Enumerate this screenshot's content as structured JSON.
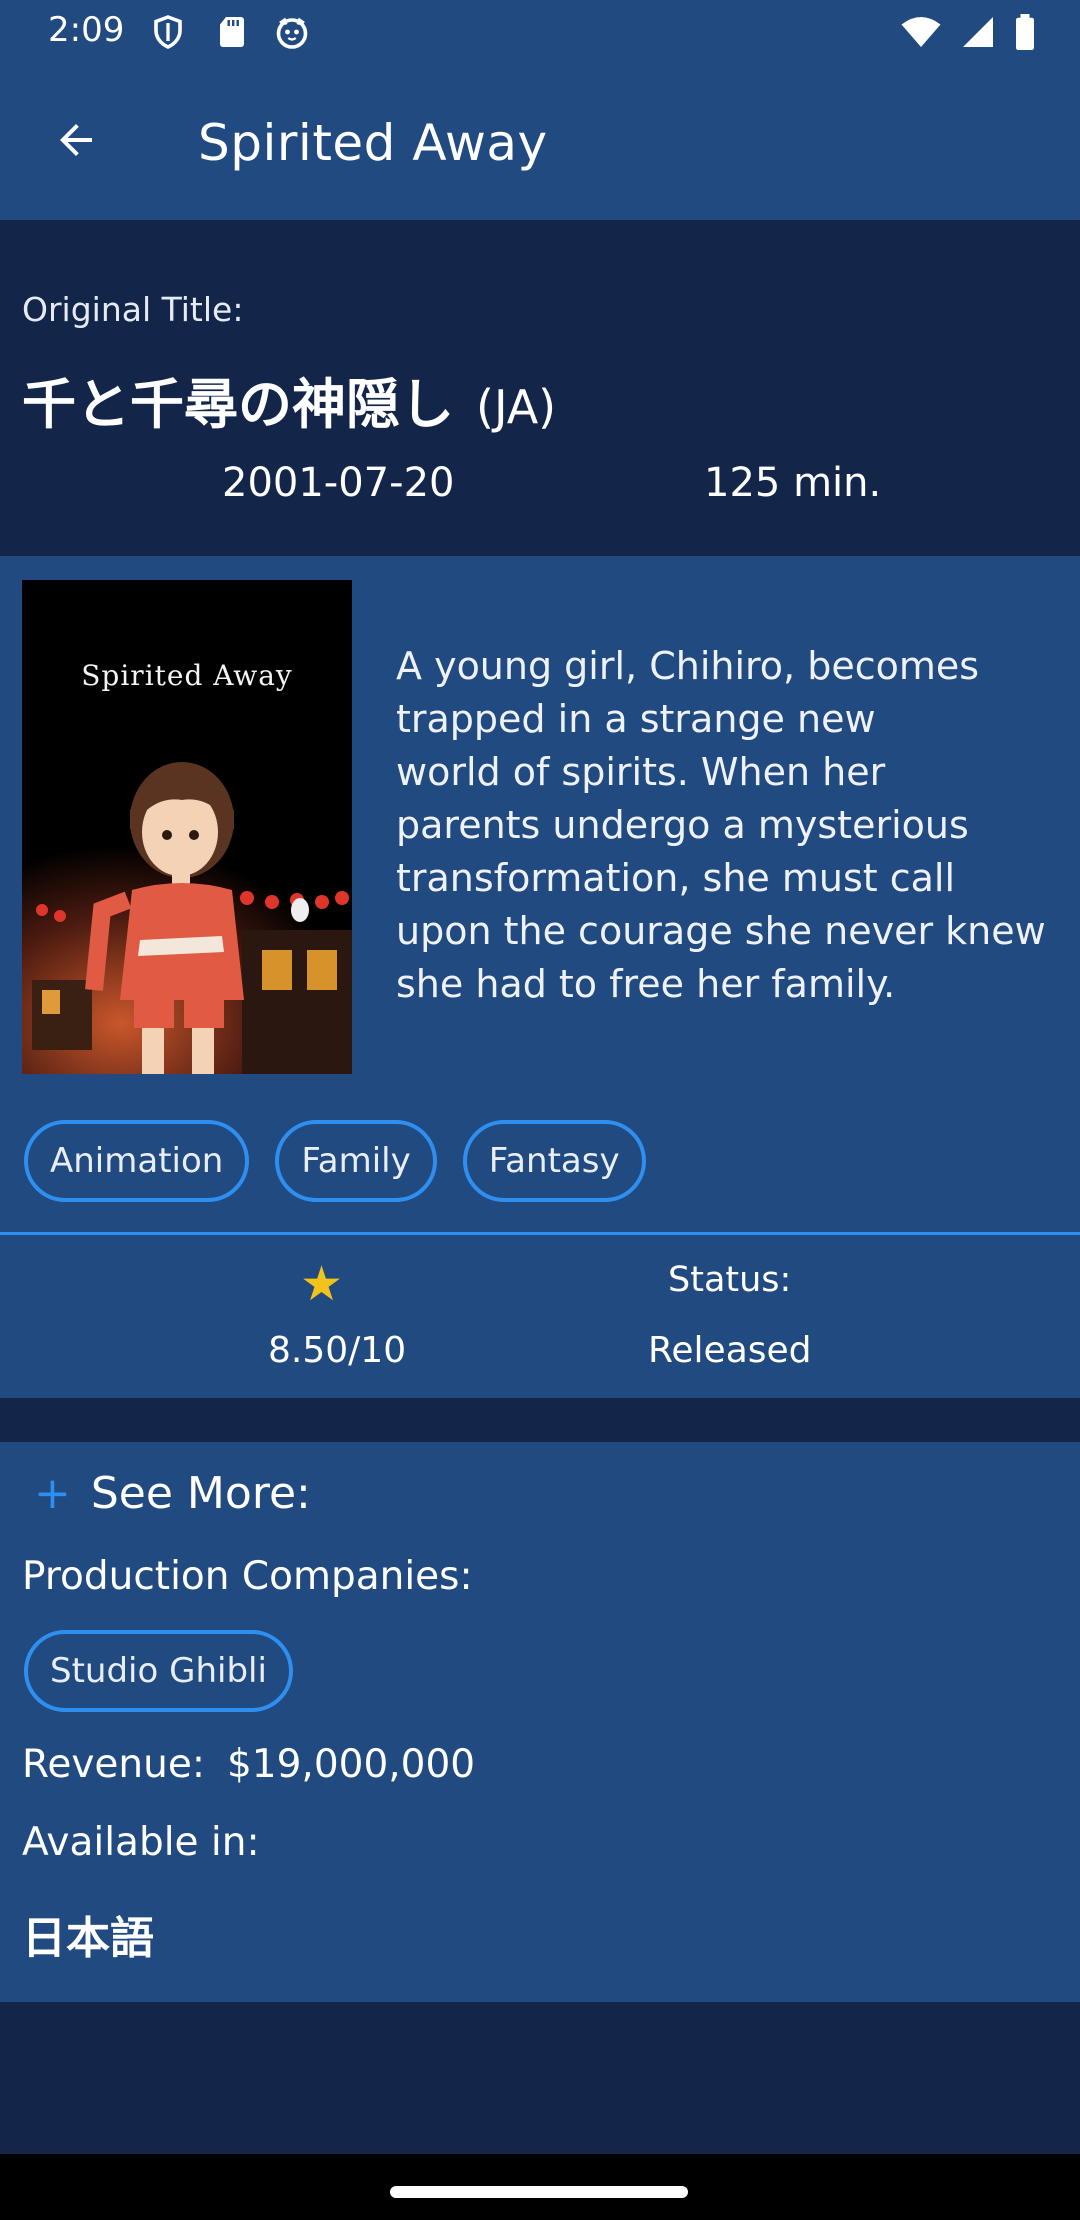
{
  "status_bar": {
    "time": "2:09",
    "left_icons": [
      "shield-icon",
      "sd-card-icon",
      "cat-face-icon"
    ],
    "right_icons": [
      "wifi-icon",
      "cell-signal-icon",
      "battery-icon"
    ]
  },
  "app_bar": {
    "back_icon": "arrow-back-icon",
    "title": "Spirited Away"
  },
  "header": {
    "original_title_label": "Original Title:",
    "original_title": "千と千尋の神隠し",
    "original_language": "(JA)",
    "release_date": "2001-07-20",
    "runtime": "125 min."
  },
  "poster": {
    "title_text": "Spirited Away"
  },
  "overview": "A young girl, Chihiro, becomes\ntrapped in a strange new\nworld of spirits. When her\nparents undergo a mysterious\ntransformation, she must call\nupon the courage she never knew\nshe had to free her family.",
  "genres": [
    "Animation",
    "Family",
    "Fantasy"
  ],
  "rating": {
    "icon": "star-icon",
    "value": "8.50/10"
  },
  "status": {
    "label": "Status:",
    "value": "Released"
  },
  "see_more": {
    "icon": "plus-icon",
    "label": "See More:",
    "production_label": "Production Companies:",
    "companies": [
      "Studio Ghibli"
    ],
    "revenue_label": "Revenue:",
    "revenue_value": "$19,000,000",
    "available_label": "Available in:",
    "languages": "日本語"
  },
  "colors": {
    "app_bar": "#214a80",
    "dark_bg": "#13264a",
    "accent": "#2f8ff0",
    "star": "#f2c31a"
  }
}
